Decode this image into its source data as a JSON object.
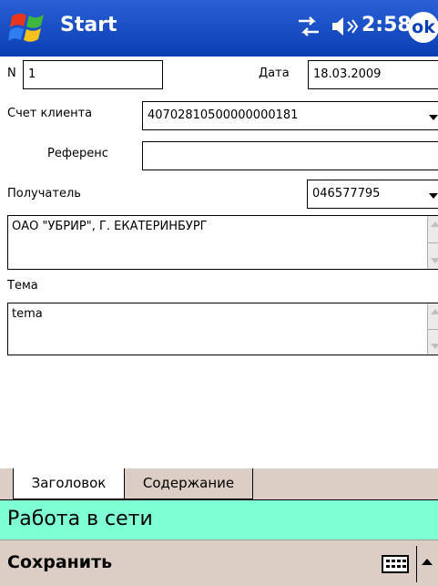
{
  "title_bar": {
    "app_title": "Start",
    "time": "2:58",
    "ok_label": "ok"
  },
  "form": {
    "number_label": "N",
    "number_value": "1",
    "date_label": "Дата",
    "date_value": "18.03.2009",
    "client_account_label": "Счет клиента",
    "client_account_value": "40702810500000000181",
    "reference_label": "Референс",
    "reference_value": "",
    "recipient_label": "Получатель",
    "recipient_bik_value": "046577795",
    "recipient_name": "ОАО \"УБРИР\", Г. ЕКАТЕРИНБУРГ",
    "subject_label": "Тема",
    "subject_value": "tema"
  },
  "tabs": [
    {
      "label": "Заголовок",
      "active": true
    },
    {
      "label": "Содержание",
      "active": false
    }
  ],
  "notification": "Работа в сети",
  "menu_bar": {
    "save_label": "Сохранить"
  },
  "colors": {
    "title_bar": "#0a3fb4",
    "notification_bg": "#7fffd4",
    "menu_bg": "#dccdc5"
  }
}
